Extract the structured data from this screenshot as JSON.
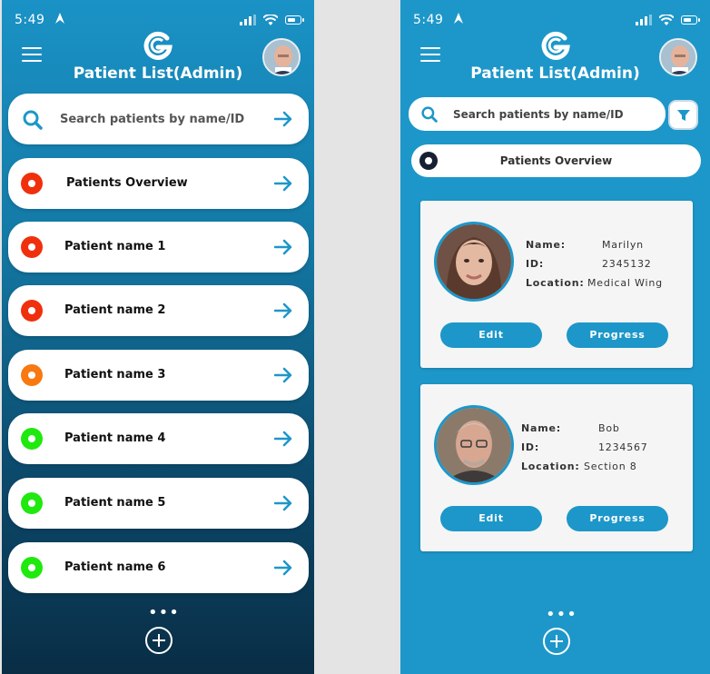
{
  "left_screen": {
    "status_bar": {
      "time": "5:49"
    },
    "title": "Patient List(Admin)",
    "search": {
      "placeholder": "Search patients by name/ID"
    },
    "overview": {
      "label": "Patients Overview",
      "dot_color": "#f0300d"
    },
    "patients": [
      {
        "name": "Patient name 1",
        "dot_color": "#f0300d"
      },
      {
        "name": "Patient name 2",
        "dot_color": "#f0300d"
      },
      {
        "name": "Patient name 3",
        "dot_color": "#f87911"
      },
      {
        "name": "Patient name 4",
        "dot_color": "#1fe90e"
      },
      {
        "name": "Patient name 5",
        "dot_color": "#1fe90e"
      },
      {
        "name": "Patient name 6",
        "dot_color": "#1fe90e"
      }
    ],
    "more_label": "•••"
  },
  "right_screen": {
    "status_bar": {
      "time": "5:49"
    },
    "title": "Patient List(Admin)",
    "search": {
      "placeholder": "Search patients by name/ID"
    },
    "overview": {
      "label": "Patients Overview"
    },
    "cards": [
      {
        "name_label": "Name:",
        "name": "Marilyn",
        "id_label": "ID:",
        "id": "2345132",
        "location_label": "Location:",
        "location": "Medical Wing",
        "edit_label": "Edit",
        "progress_label": "Progress"
      },
      {
        "name_label": "Name:",
        "name": "Bob",
        "id_label": "ID:",
        "id": "1234567",
        "location_label": "Location:",
        "location": "Section 8",
        "edit_label": "Edit",
        "progress_label": "Progress"
      }
    ],
    "more_label": "•••"
  },
  "colors": {
    "accent": "#1d97c9",
    "critical": "#f0300d",
    "warning": "#f87911",
    "stable": "#1fe90e"
  }
}
